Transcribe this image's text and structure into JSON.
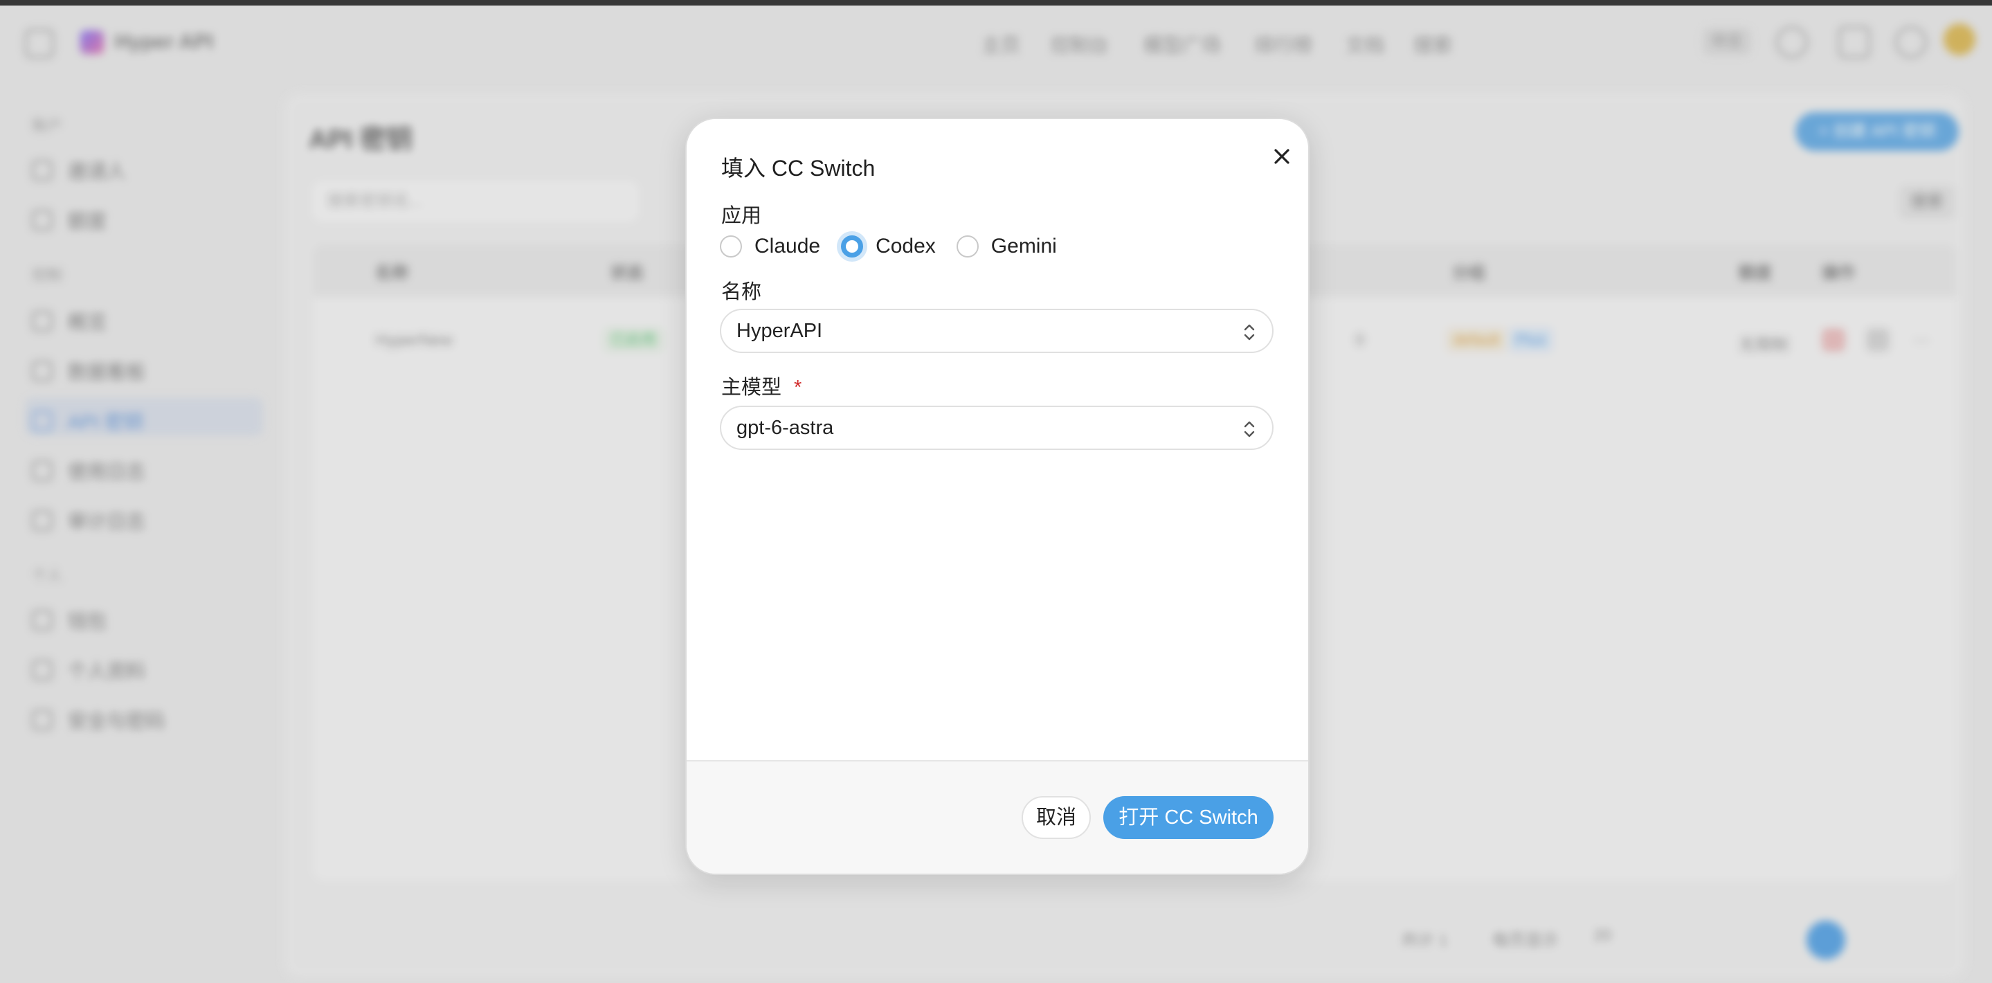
{
  "background": {
    "brand": "Hyper API",
    "nav": [
      "主页",
      "控制台",
      "模型广场",
      "排行榜",
      "文档",
      "搜索"
    ],
    "language": "中文",
    "sidebar": {
      "section_1": "账户",
      "items_1": [
        "邀请人",
        "额度"
      ],
      "section_2": "控制",
      "items_2": [
        "概览",
        "数据看板",
        "API 密钥",
        "使用日志",
        "审计日志"
      ],
      "section_3": "个人",
      "items_3": [
        "钱包",
        "个人资料",
        "安全与密码"
      ]
    },
    "page_title": "API 密钥",
    "create_button": "+ 创建 API 密钥",
    "search_placeholder": "搜索密钥名...",
    "filter_button": "搜索",
    "table_headers": [
      "名称",
      "状态",
      "分组",
      "额度",
      "操作"
    ],
    "row": {
      "name": "HyperNew",
      "status": "已启用",
      "count": "0",
      "group_a": "default",
      "group_b": "Plus",
      "quota": "无限制"
    },
    "pager": {
      "total": "共计 1",
      "per_page_label": "每页显示",
      "per_page": "20"
    }
  },
  "modal": {
    "title": "填入 CC Switch",
    "app_label": "应用",
    "apps": [
      {
        "label": "Claude",
        "checked": false
      },
      {
        "label": "Codex",
        "checked": true
      },
      {
        "label": "Gemini",
        "checked": false
      }
    ],
    "name_label": "名称",
    "name_value": "HyperAPI",
    "model_label": "主模型",
    "required_mark": "*",
    "model_value": "gpt-6-astra",
    "cancel_label": "取消",
    "open_label": "打开 CC Switch"
  },
  "colors": {
    "accent": "#4aa0e6",
    "required": "#d12b2b"
  }
}
